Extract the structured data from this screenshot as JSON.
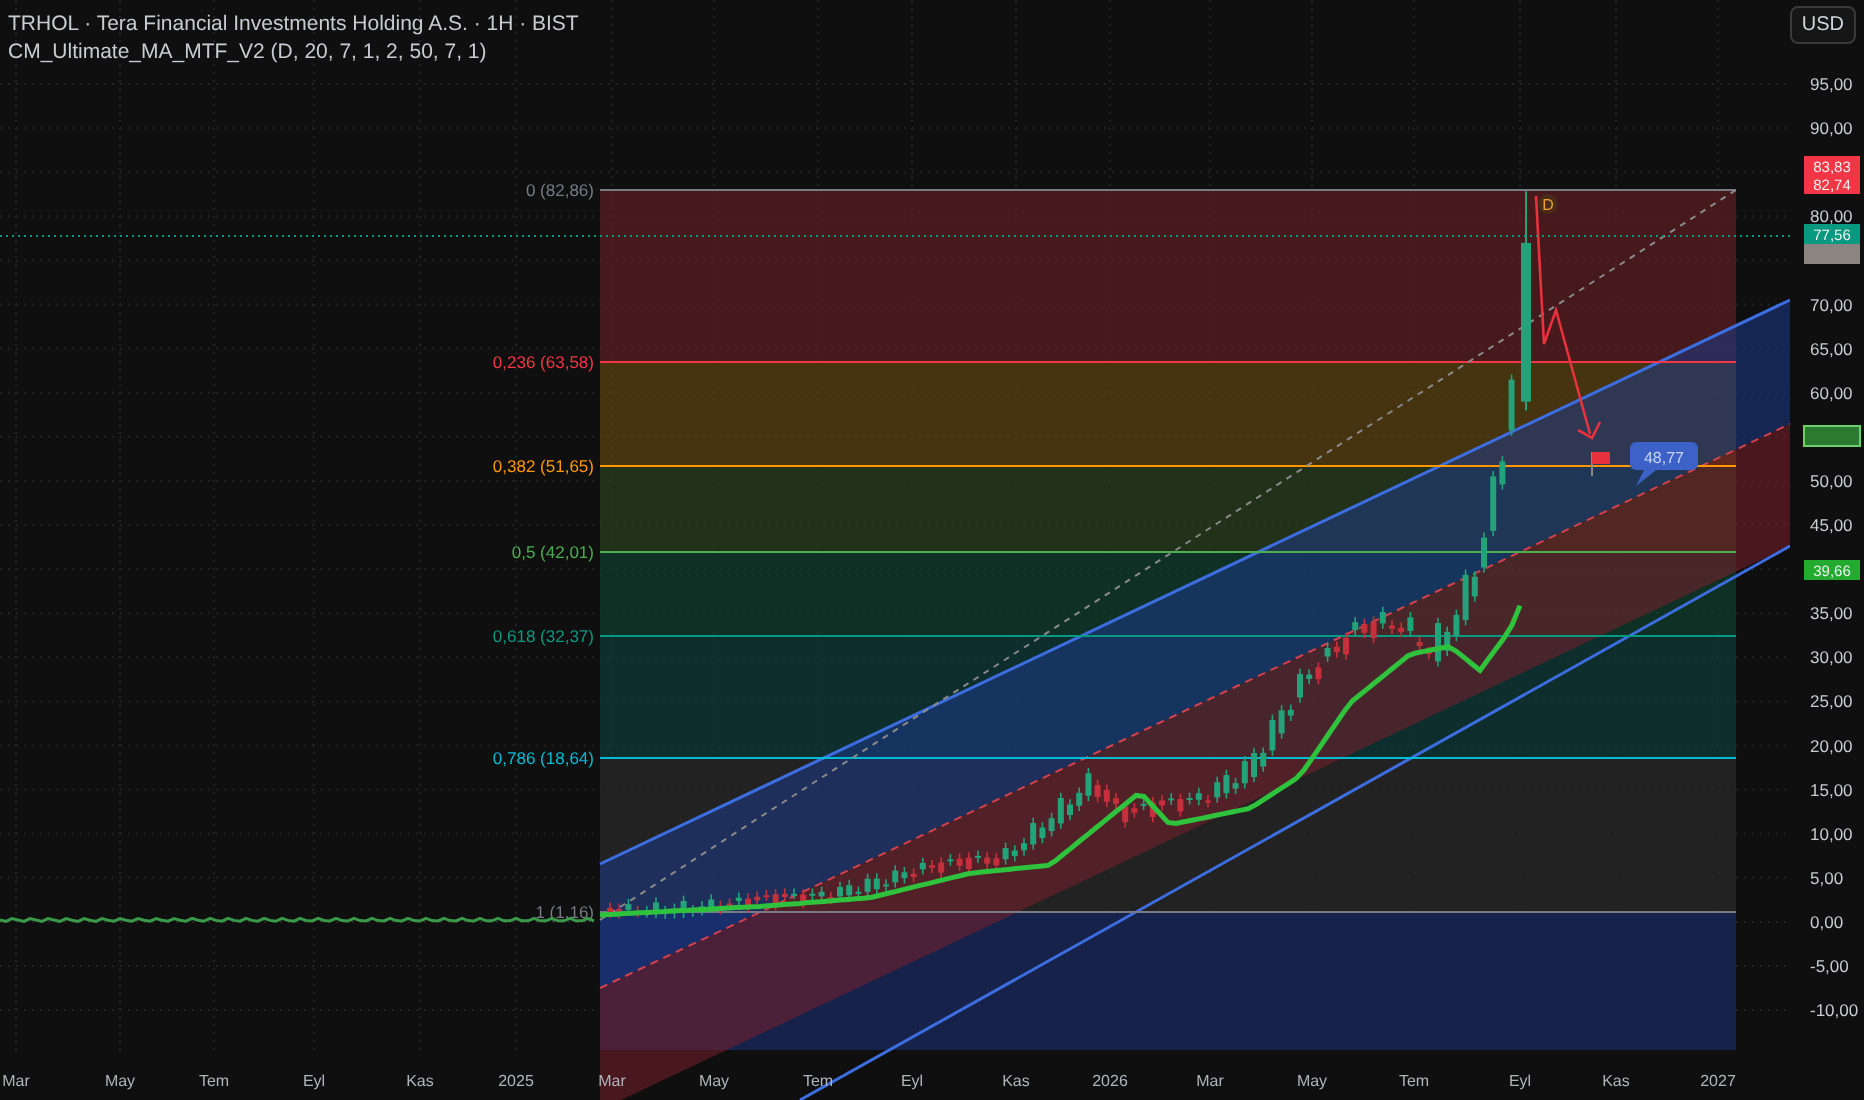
{
  "header": {
    "symbol_line": "TRHOL · Tera Financial Investments Holding A.S. · 1H · BIST",
    "indicator_line": "CM_Ultimate_MA_MTF_V2 (D, 20, 7, 1, 2, 50, 7, 1)"
  },
  "currency_button": "USD",
  "price_axis": [
    "95,00",
    "90,00",
    "80,00",
    "70,00",
    "65,00",
    "60,00",
    "50,00",
    "45,00",
    "35,00",
    "30,00",
    "25,00",
    "20,00",
    "15,00",
    "10,00",
    "5,00",
    "0,00",
    "-5,00",
    "-10,00"
  ],
  "time_axis": [
    "Mar",
    "May",
    "Tem",
    "Eyl",
    "Kas",
    "2025",
    "Mar",
    "May",
    "Tem",
    "Eyl",
    "Kas",
    "2026",
    "Mar",
    "May",
    "Tem",
    "Eyl",
    "Kas",
    "2027"
  ],
  "fib_levels": [
    {
      "label": "0 (82,86)",
      "color": "#787b86"
    },
    {
      "label": "0,236 (63,58)",
      "color": "#f23645"
    },
    {
      "label": "0,382 (51,65)",
      "color": "#ff9800"
    },
    {
      "label": "0,5 (42,01)",
      "color": "#4caf50"
    },
    {
      "label": "0,618 (32,37)",
      "color": "#089981"
    },
    {
      "label": "0,786 (18,64)",
      "color": "#00bcd4"
    },
    {
      "label": "1 (1,16)",
      "color": "#787b86"
    }
  ],
  "price_tags": [
    {
      "text": "83,83",
      "color": "#f23645"
    },
    {
      "text": "82,74",
      "color": "#f23645"
    },
    {
      "text": "77,56",
      "color": "#089981"
    },
    {
      "text": "39,66",
      "color": "#22ab2f"
    }
  ],
  "marker": "D",
  "callout": "48,77"
}
